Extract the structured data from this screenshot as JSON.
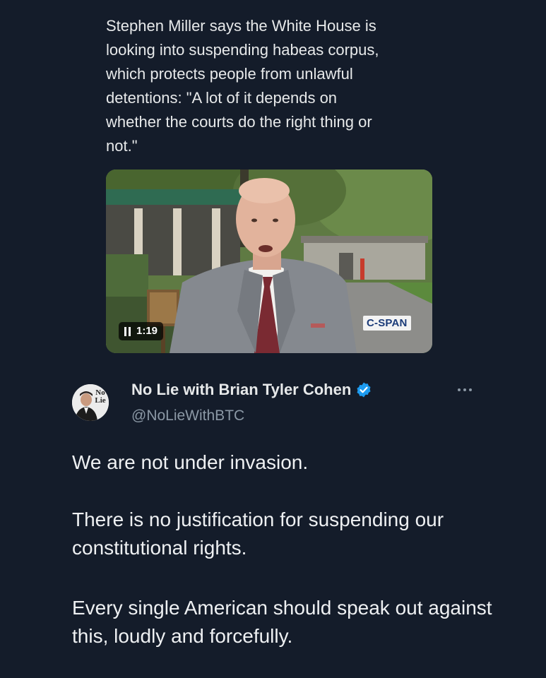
{
  "quoted_post": {
    "text": "Stephen Miller says the White House is\nlooking into suspending habeas corpus,\nwhich protects people from unlawful\ndetentions: \"A lot of it depends on\nwhether the courts do the right thing or\nnot.\"",
    "video": {
      "duration": "1:19",
      "watermark": "C-SPAN"
    }
  },
  "post": {
    "avatar_text": [
      "No",
      "Lie"
    ],
    "author_name": "No Lie with Brian Tyler Cohen",
    "handle": "@NoLieWithBTC",
    "paragraphs": [
      "We are not under invasion.",
      "There is no justification for suspending our constitutional rights.",
      "Every single American should speak out against this, loudly and forcefully."
    ]
  },
  "colors": {
    "background": "#141c2a",
    "text": "#e7e9ea",
    "secondary": "#8b98a5",
    "verified": "#1d9bf0"
  }
}
